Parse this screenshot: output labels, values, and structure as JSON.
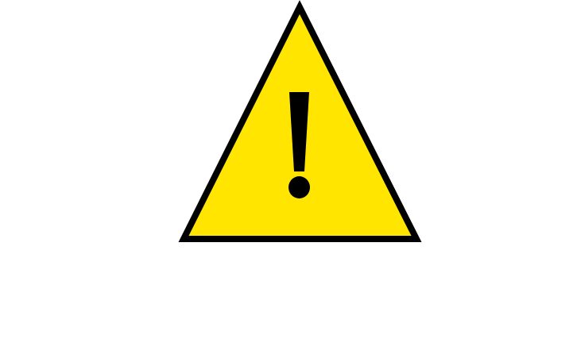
{
  "warning_sign": {
    "icon": "warning-triangle-icon",
    "glyph": "!",
    "colors": {
      "fill": "#FFE500",
      "stroke": "#000000",
      "glyph": "#000000",
      "background": "#FFFFFF"
    }
  }
}
